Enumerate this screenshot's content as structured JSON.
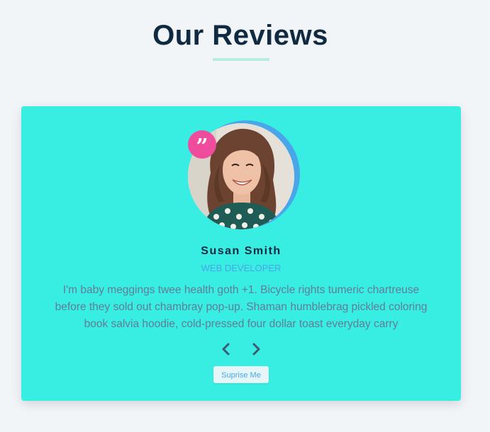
{
  "header": {
    "title": "Our Reviews"
  },
  "review": {
    "name": "Susan Smith",
    "job": "WEB DEVELOPER",
    "text": "I'm baby meggings twee health goth +1. Bicycle rights tumeric chartreuse before they sold out chambray pop-up. Shaman humblebrag pickled coloring book salvia hoodie, cold-pressed four dollar toast everyday carry",
    "image_alt": "Susan Smith"
  },
  "controls": {
    "prev_icon": "chevron-left-icon",
    "next_icon": "chevron-right-icon",
    "random_label": "Suprise Me"
  },
  "colors": {
    "background": "#f1f5f8",
    "card": "#38ede1",
    "title": "#102a42",
    "accent": "#49a6e9",
    "quote": "#f04c9d",
    "underline": "#b8ecde",
    "text": "#617d98"
  }
}
